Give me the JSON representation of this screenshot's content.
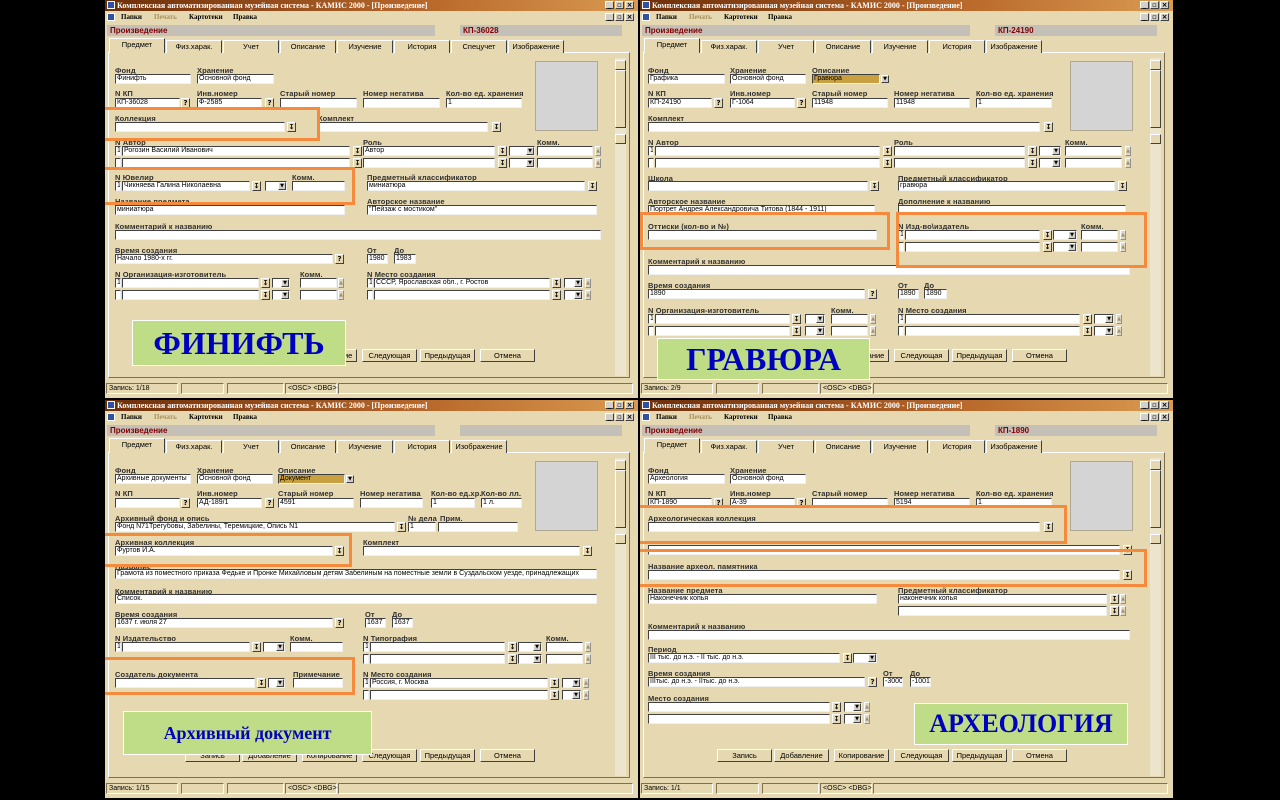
{
  "common": {
    "window_title": "Комплексная автоматизированная музейная система - КАМИС 2000 - [Произведение]",
    "menu": [
      "Папки",
      "Печать",
      "Картотеки",
      "Правка"
    ],
    "record_type": "Произведение",
    "window_buttons": [
      "_",
      "▫",
      "×"
    ],
    "buttons": [
      "Запись",
      "Добавление",
      "Копирование",
      "Следующая",
      "Предыдущая",
      "Отмена"
    ],
    "osc": "<OSC>",
    "dbg": "<DBG>",
    "dropdown_glyph": "↧",
    "question_glyph": "?",
    "combo_glyph": "▼",
    "spin_glyph": "▲"
  },
  "panels": [
    {
      "kp": "КП-36028",
      "tabs": [
        "Предмет",
        "Физ.харак.",
        "Учет",
        "Описание",
        "Изучение",
        "История",
        "Спецучет",
        "Изображение"
      ],
      "status": "Запись: 1/18",
      "banner": "ФИНИФТЬ",
      "labels": {
        "fond": "Фонд",
        "storage": "Хранение",
        "n_kp": "N  КП",
        "inv": "Инв.номер",
        "old": "Старый номер",
        "neg": "Номер негатива",
        "qty": "Кол-во ед. хранения",
        "collection": "Коллекция",
        "set": "Комплект",
        "author": "N Автор",
        "role": "Роль",
        "comm": "Комм.",
        "jeweler": "N Ювелир",
        "classifier": "Предметный классификатор",
        "item_name": "Название предмета",
        "author_title": "Авторское название",
        "comment": "Комментарий к названию",
        "created": "Время создания",
        "from": "От",
        "to": "До",
        "org": "N Организация-изготовитель",
        "place": "N Место создания"
      },
      "values": {
        "fond": "Финифть",
        "storage": "Основной фонд",
        "n_kp": "КП-36028",
        "inv": "Ф-2585",
        "qty": "1",
        "row_num": "1",
        "author1": "Рогозин Василий Иванович",
        "role1": "Автор",
        "jeweler": "Чикняева Галина Николаевна",
        "classifier": "миниатюра",
        "item_name": "миниатюра",
        "author_title": "\"Пейзаж с мостиком\"",
        "created": "Начало 1980-х гг.",
        "from": "1980",
        "to": "1983",
        "place": "СССР, Ярославская обл., г. Ростов"
      }
    },
    {
      "kp": "КП-24190",
      "tabs": [
        "Предмет",
        "Физ.харак.",
        "Учет",
        "Описание",
        "Изучение",
        "История",
        "Изображение"
      ],
      "status": "Запись: 2/9",
      "banner": "ГРАВЮРА",
      "labels": {
        "fond": "Фонд",
        "storage": "Хранение",
        "description": "Описание",
        "n_kp": "N  КП",
        "inv": "Инв.номер",
        "old": "Старый номер",
        "neg": "Номер негатива",
        "qty": "Кол-во ед. хранения",
        "set": "Комплект",
        "author": "N Автор",
        "role": "Роль",
        "comm": "Комм.",
        "school": "Школа",
        "classifier": "Предметный классификатор",
        "author_title": "Авторское название",
        "addition": "Дополнение к названию",
        "prints": "Оттиски (кол-во и №)",
        "publisher": "N Изд-во\\издатель",
        "comment": "Комментарий к названию",
        "created": "Время создания",
        "from": "От",
        "to": "До",
        "org": "N Организация-изготовитель",
        "place": "N Место создания"
      },
      "values": {
        "fond": "Графика",
        "storage": "Основной фонд",
        "description": "Гравюра",
        "n_kp": "КП-24190",
        "inv": "Г-1064",
        "old": "11948",
        "neg": "11948",
        "qty": "1",
        "row_num": "1",
        "classifier": "гравюра",
        "author_title": "Портрет Андрея Александровича Титова (1844 - 1911)",
        "created": "1890",
        "from": "1890",
        "to": "1890"
      }
    },
    {
      "kp": "",
      "tabs": [
        "Предмет",
        "Физ.харак.",
        "Учет",
        "Описание",
        "Изучение",
        "История",
        "Изображение"
      ],
      "status": "Запись: 1/15",
      "banner": "Архивный документ",
      "labels": {
        "fond": "Фонд",
        "storage": "Хранение",
        "description": "Описание",
        "n_kp": "N  КП",
        "inv": "Инв.номер",
        "old": "Старый номер",
        "neg": "Номер негатива",
        "qty": "Кол-во ед.хр.",
        "sheets": "Кол-во лл.",
        "archive_fond": "Архивный фонд и опись",
        "case_no": "№ дела",
        "note": "Прим.",
        "archive_collection": "Архивная коллекция",
        "set": "Комплект",
        "title": "Название",
        "comment": "Комментарий к названию",
        "created": "Время создания",
        "from": "От",
        "to": "До",
        "publisher": "N Издательство",
        "comm": "Комм.",
        "printing": "N Типография",
        "doc_creator": "Создатель документа",
        "remark": "Примечание",
        "place": "N Место создания"
      },
      "values": {
        "fond": "Архивные документы",
        "storage": "Основной фонд",
        "description": "Документ",
        "inv": "АД-189/1",
        "old": "4591",
        "qty": "1",
        "sheets": "1 л.",
        "archive_fond": "Фонд N71Трегубовы, Забелины, Теремицкие, Опись N1",
        "case_no": "1",
        "archive_collection": "Фуртов И.А.",
        "title": "Грамота из поместного приказа Федьке и Пронке Михайловым детям Забелиным на поместные земли в Суздальском уезде, принадлежащих",
        "comment": "Список.",
        "created": "1637 г. июля 27",
        "from": "1637",
        "to": "1637",
        "row_num": "1",
        "place": "Россия, г. Москва"
      }
    },
    {
      "kp": "КП-1890",
      "tabs": [
        "Предмет",
        "Физ.харак.",
        "Учет",
        "Описание",
        "Изучение",
        "История",
        "Изображение"
      ],
      "status": "Запись: 1/1",
      "banner": "АРХЕОЛОГИЯ",
      "labels": {
        "fond": "Фонд",
        "storage": "Хранение",
        "n_kp": "N  КП",
        "inv": "Инв.номер",
        "old": "Старый номер",
        "neg": "Номер негатива",
        "qty": "Кол-во ед. хранения",
        "arch_collection": "Археологическая коллекция",
        "arch_site": "Название археол. памятника",
        "item_name": "Название предмета",
        "classifier": "Предметный классификатор",
        "comment": "Комментарий к названию",
        "period": "Период",
        "created": "Время создания",
        "from": "От",
        "to": "До",
        "place": "Место создания"
      },
      "values": {
        "fond": "Археология",
        "storage": "Основной фонд",
        "n_kp": "КП-1890",
        "inv": "А-39",
        "neg": "5194",
        "qty": "1",
        "item_name": "Наконечник копья",
        "classifier": "наконечник копья",
        "period": "III тыс. до н.э. - II тыс. до н.э.",
        "created": "IIIтыс. до н.э. - IIтыс. до н.э.",
        "from": "-3000",
        "to": "-1001"
      }
    }
  ]
}
